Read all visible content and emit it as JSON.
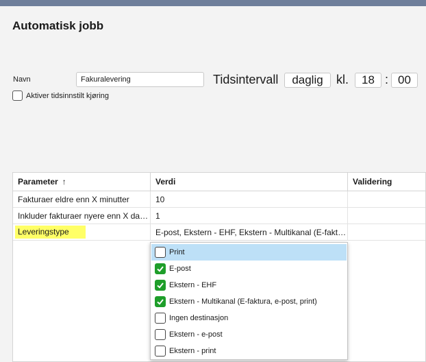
{
  "header": {
    "title": "Automatisk jobb"
  },
  "form": {
    "name_label": "Navn",
    "name_value": "Fakuralevering",
    "interval_label": "Tidsintervall",
    "interval_value": "daglig",
    "time_label": "kl.",
    "hour": "18",
    "colon": ":",
    "minute": "00",
    "enable_label": "Aktiver tidsinnstilt kjøring",
    "enable_checked": false
  },
  "table": {
    "columns": [
      "Parameter",
      "Verdi",
      "Validering"
    ],
    "sort_indicator": "↑",
    "rows": [
      {
        "parameter": "Fakturaer eldre enn X minutter",
        "value": "10",
        "validation": ""
      },
      {
        "parameter": "Inkluder fakturaer nyere enn X dager",
        "value": "1",
        "validation": ""
      },
      {
        "parameter": "Leveringstype",
        "value": "E-post, Ekstern - EHF, Ekstern - Multikanal (E-faktura, e-post, print)",
        "validation": ""
      }
    ]
  },
  "dropdown": {
    "options": [
      {
        "label": "Print",
        "checked": false,
        "highlighted": true
      },
      {
        "label": "E-post",
        "checked": true,
        "highlighted": false
      },
      {
        "label": "Ekstern - EHF",
        "checked": true,
        "highlighted": false
      },
      {
        "label": "Ekstern - Multikanal (E-faktura, e-post, print)",
        "checked": true,
        "highlighted": false
      },
      {
        "label": "Ingen destinasjon",
        "checked": false,
        "highlighted": false
      },
      {
        "label": "Ekstern - e-post",
        "checked": false,
        "highlighted": false
      },
      {
        "label": "Ekstern - print",
        "checked": false,
        "highlighted": false
      }
    ]
  },
  "colors": {
    "topbar": "#6e7e9a",
    "check_green": "#1e9e2a",
    "highlight_yellow": "#ffff66",
    "option_hover": "#bde0f7"
  }
}
